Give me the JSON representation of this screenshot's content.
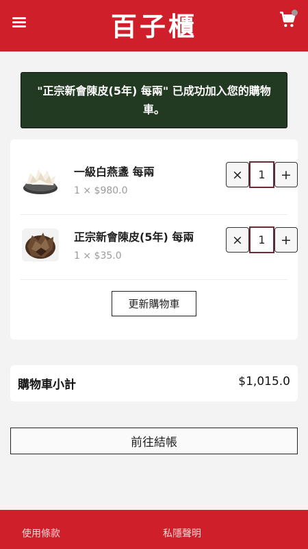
{
  "header": {
    "logo_text": "百子櫃"
  },
  "notice": {
    "message": "\"正宗新會陳皮(5年) 每兩\" 已成功加入您的購物車。"
  },
  "cart": {
    "items": [
      {
        "name": "一級白燕盞 每兩",
        "price_line": "1 × $980.0",
        "quantity": "1",
        "thumbnail": "white-bird-nest-image"
      },
      {
        "name": "正宗新會陳皮(5年) 每兩",
        "price_line": "1 × $35.0",
        "quantity": "1",
        "thumbnail": "dried-tangerine-peel-image"
      }
    ],
    "remove_label": "×",
    "increment_label": "+",
    "update_label": "更新購物車"
  },
  "subtotal": {
    "label": "購物車小計",
    "value": "$1,015.0"
  },
  "checkout": {
    "label": "前往結帳"
  },
  "footer": {
    "terms_label": "使用條款",
    "privacy_label": "私隱聲明"
  },
  "colors": {
    "brand_red": "#cf1f2a",
    "notice_green": "#233a22",
    "qty_border": "#6c2a35"
  }
}
